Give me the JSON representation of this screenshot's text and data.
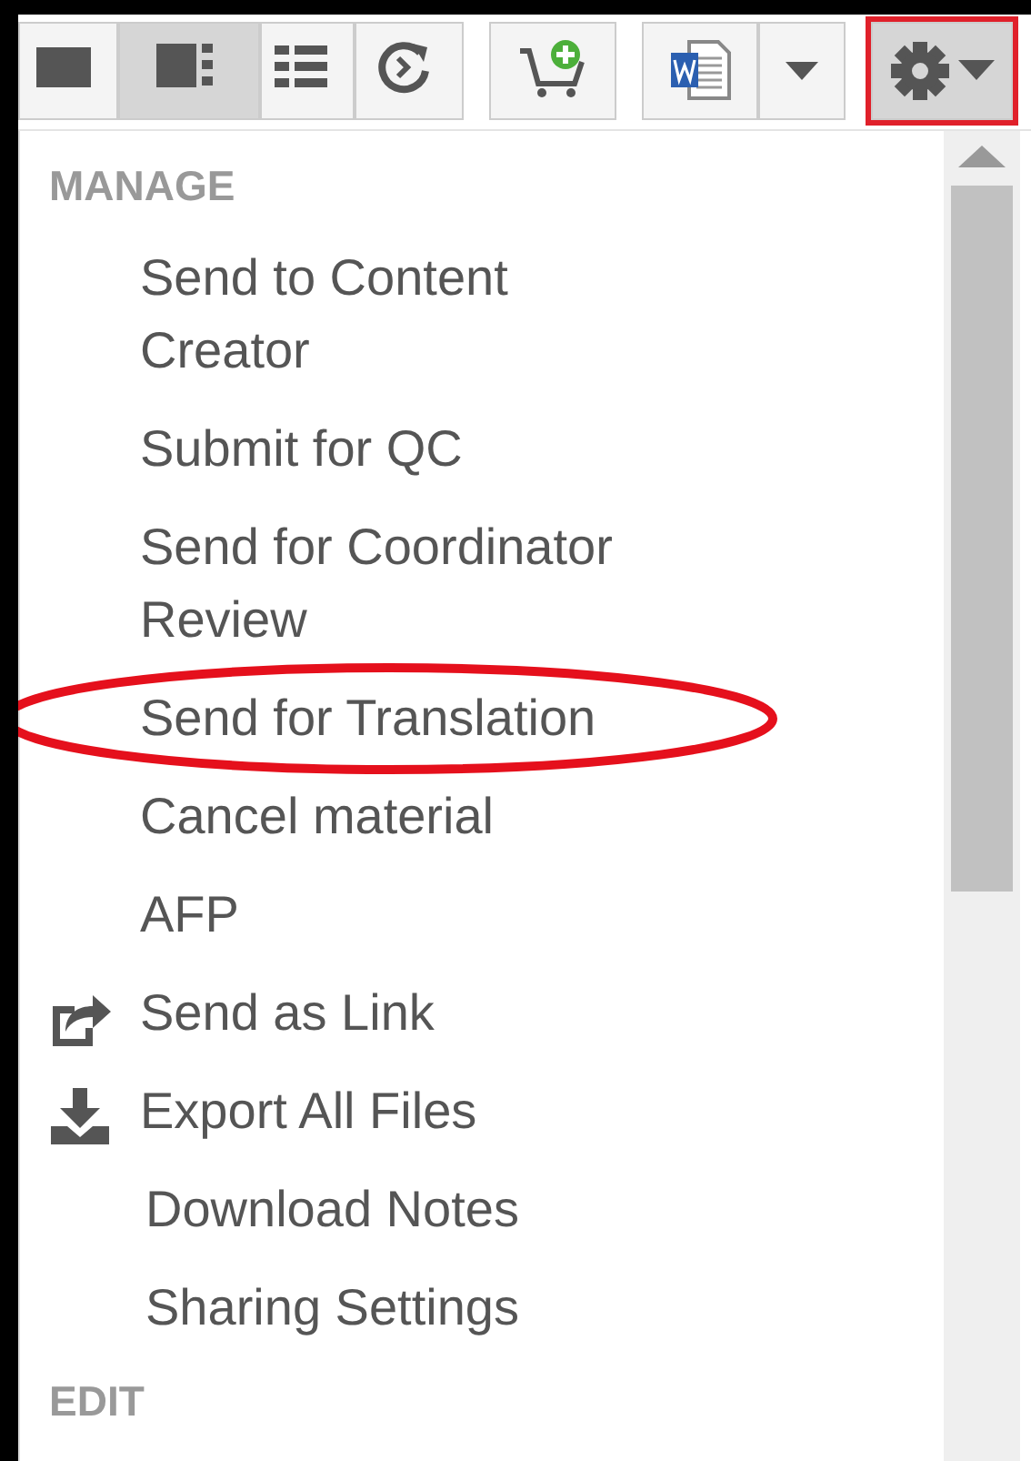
{
  "toolbar": [
    {
      "kind": "tiles",
      "selected": false
    },
    {
      "kind": "list",
      "selected": true
    },
    {
      "kind": "grid",
      "selected": false
    },
    {
      "kind": "cycle",
      "selected": false
    },
    {
      "kind": "cart-add",
      "selected": false
    },
    {
      "kind": "word",
      "selected": false
    },
    {
      "kind": "caret",
      "selected": false
    },
    {
      "kind": "gear",
      "selected": true,
      "highlighted": true
    }
  ],
  "menu": {
    "sections": [
      {
        "title": "MANAGE",
        "items": [
          {
            "label": "Send to Content Creator",
            "kind": "text",
            "highlighted": false
          },
          {
            "label": "Submit for QC",
            "kind": "text",
            "highlighted": false
          },
          {
            "label": "Send for Coordinator Review",
            "kind": "text",
            "highlighted": false
          },
          {
            "label": "Send for Translation",
            "kind": "text",
            "highlighted": true
          },
          {
            "label": "Cancel material",
            "kind": "text",
            "highlighted": false
          },
          {
            "label": "AFP",
            "kind": "text",
            "highlighted": false
          },
          {
            "label": "Send as Link",
            "kind": "share",
            "highlighted": false
          },
          {
            "label": "Export All Files",
            "kind": "export",
            "highlighted": false
          },
          {
            "label": "Download Notes",
            "kind": "text-indent",
            "highlighted": false
          },
          {
            "label": "Sharing Settings",
            "kind": "text-indent",
            "highlighted": false
          }
        ]
      },
      {
        "title": "EDIT"
      }
    ]
  }
}
